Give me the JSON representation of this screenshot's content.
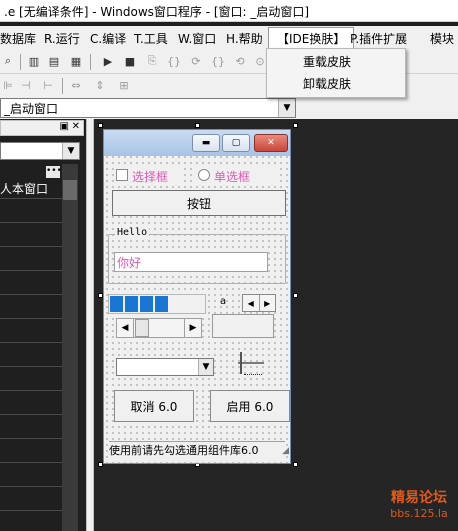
{
  "window": {
    "title": ".e [无编译条件] - Windows窗口程序 - [窗口: _启动窗口]"
  },
  "menubar": {
    "items": [
      {
        "label": "数据库"
      },
      {
        "label": "R.运行"
      },
      {
        "label": "C.编译"
      },
      {
        "label": "T.工具"
      },
      {
        "label": "W.窗口"
      },
      {
        "label": "H.帮助"
      },
      {
        "label": "【IDE换肤】"
      },
      {
        "label": "P.插件扩展"
      },
      {
        "label": "模块"
      }
    ]
  },
  "skin_menu": {
    "items": [
      {
        "label": "重载皮肤"
      },
      {
        "label": "卸载皮肤"
      }
    ]
  },
  "window_selector": {
    "value": "_启动窗口"
  },
  "left_panel": {
    "list_header": "人本窗口"
  },
  "form": {
    "checkbox_label": "选择框",
    "radio_label": "单选框",
    "button_label": "按钮",
    "group_label": "Hello",
    "editbox_value": "你好",
    "label_a": "a",
    "cancel_button": "取消 6.0",
    "enable_button": "启用 6.0",
    "status_text": "使用前请先勾选通用组件库6.0",
    "progress_fraction": 0.62
  },
  "watermark": {
    "title": "精易论坛",
    "url": "bbs.125.la"
  },
  "colors": {
    "accent_blue": "#1a76d2",
    "pink_text": "#e05ab4",
    "watermark": "#e05a1a"
  }
}
